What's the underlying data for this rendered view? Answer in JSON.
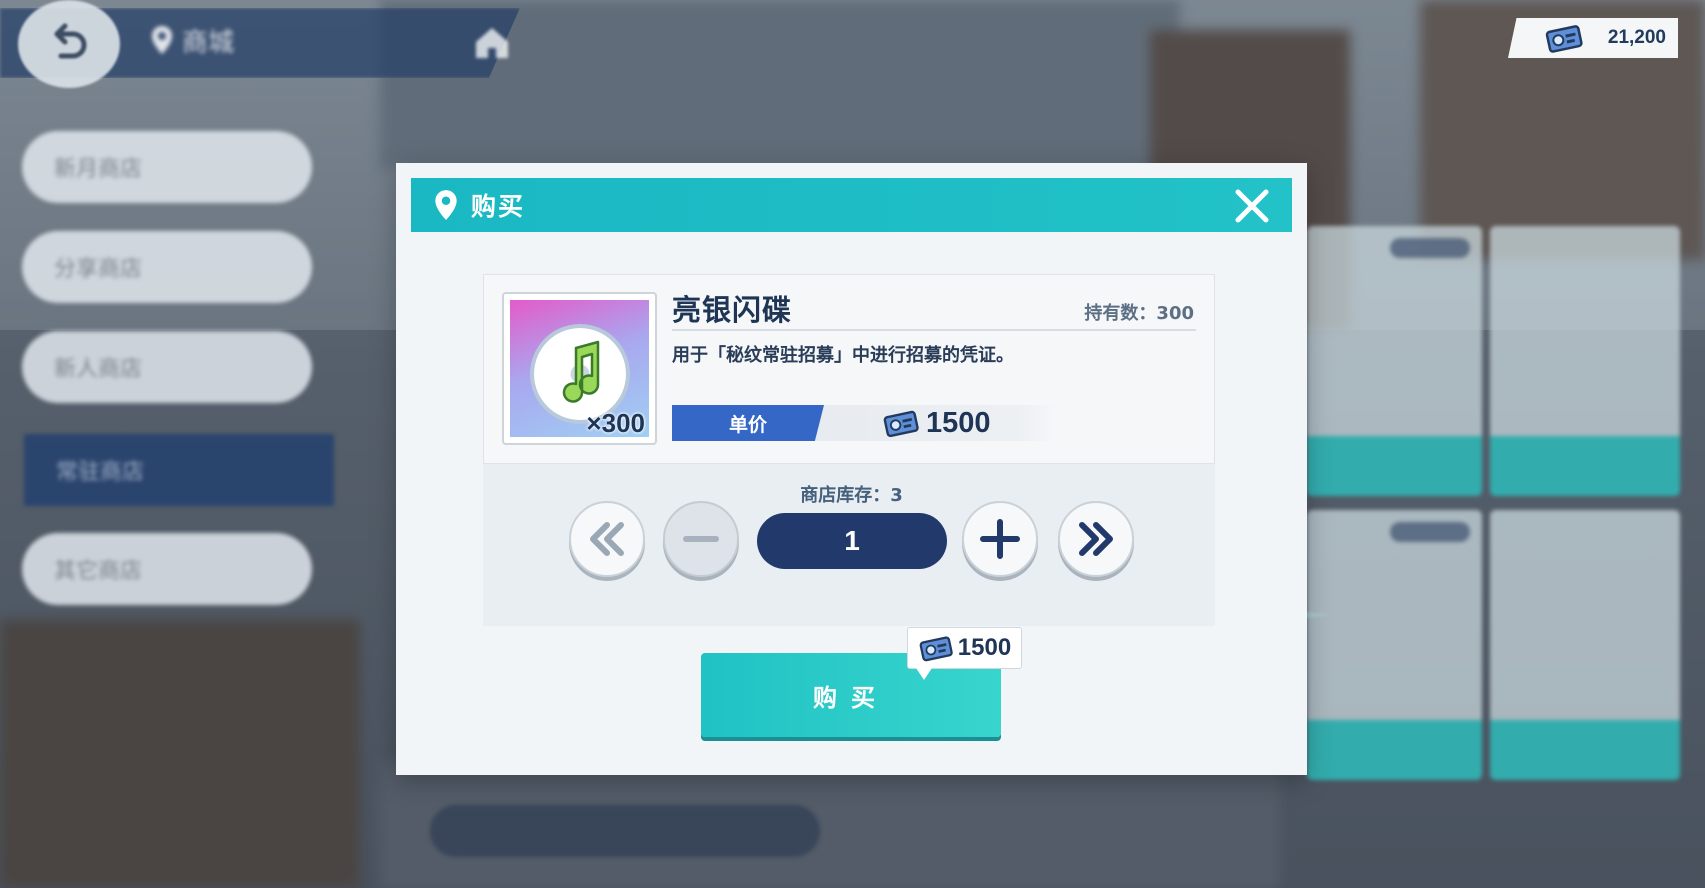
{
  "top_bar": {
    "location_label": "商城",
    "currency_value": "21,200"
  },
  "sidebar": {
    "items": [
      {
        "label": "新月商店",
        "active": false
      },
      {
        "label": "分享商店",
        "active": false
      },
      {
        "label": "新人商店",
        "active": false
      },
      {
        "label": "常驻商店",
        "active": true
      },
      {
        "label": "其它商店",
        "active": false
      }
    ]
  },
  "dialog": {
    "title": "购买",
    "item": {
      "name": "亮银闪碟",
      "owned_label": "持有数：300",
      "description": "用于「秘纹常驻招募」中进行招募的凭证。",
      "thumb_quantity": "×300",
      "unit_price_label": "单价",
      "unit_price": "1500"
    },
    "stock_label": "商店库存：3",
    "quantity": "1",
    "buy_label": "购买",
    "total_cost": "1500"
  },
  "colors": {
    "header": "#1ab8c3",
    "accent_blue": "#3567c6",
    "navy": "#223a6b",
    "buy_button": "#20c2c4"
  },
  "icons": {
    "back": "back-arrow-icon",
    "location": "location-pin-icon",
    "home": "home-icon",
    "currency": "ticket-card-icon",
    "close": "close-icon",
    "min": "double-chevron-left-icon",
    "minus": "minus-icon",
    "plus": "plus-icon",
    "max": "double-chevron-right-icon"
  }
}
